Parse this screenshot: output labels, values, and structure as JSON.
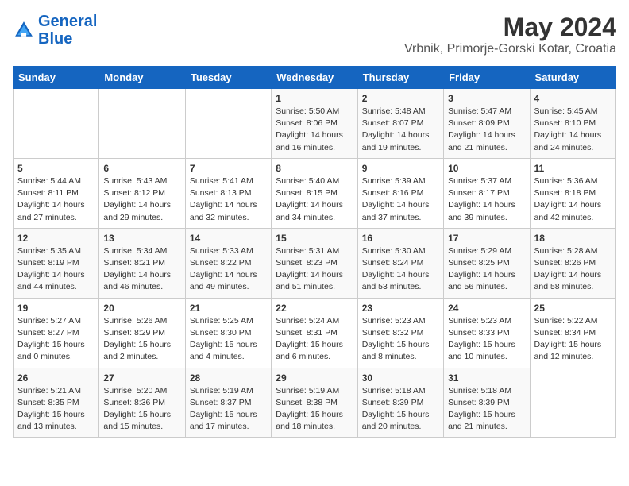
{
  "logo": {
    "line1": "General",
    "line2": "Blue"
  },
  "title": "May 2024",
  "subtitle": "Vrbnik, Primorje-Gorski Kotar, Croatia",
  "days_of_week": [
    "Sunday",
    "Monday",
    "Tuesday",
    "Wednesday",
    "Thursday",
    "Friday",
    "Saturday"
  ],
  "weeks": [
    [
      {
        "day": "",
        "info": ""
      },
      {
        "day": "",
        "info": ""
      },
      {
        "day": "",
        "info": ""
      },
      {
        "day": "1",
        "info": "Sunrise: 5:50 AM\nSunset: 8:06 PM\nDaylight: 14 hours and 16 minutes."
      },
      {
        "day": "2",
        "info": "Sunrise: 5:48 AM\nSunset: 8:07 PM\nDaylight: 14 hours and 19 minutes."
      },
      {
        "day": "3",
        "info": "Sunrise: 5:47 AM\nSunset: 8:09 PM\nDaylight: 14 hours and 21 minutes."
      },
      {
        "day": "4",
        "info": "Sunrise: 5:45 AM\nSunset: 8:10 PM\nDaylight: 14 hours and 24 minutes."
      }
    ],
    [
      {
        "day": "5",
        "info": "Sunrise: 5:44 AM\nSunset: 8:11 PM\nDaylight: 14 hours and 27 minutes."
      },
      {
        "day": "6",
        "info": "Sunrise: 5:43 AM\nSunset: 8:12 PM\nDaylight: 14 hours and 29 minutes."
      },
      {
        "day": "7",
        "info": "Sunrise: 5:41 AM\nSunset: 8:13 PM\nDaylight: 14 hours and 32 minutes."
      },
      {
        "day": "8",
        "info": "Sunrise: 5:40 AM\nSunset: 8:15 PM\nDaylight: 14 hours and 34 minutes."
      },
      {
        "day": "9",
        "info": "Sunrise: 5:39 AM\nSunset: 8:16 PM\nDaylight: 14 hours and 37 minutes."
      },
      {
        "day": "10",
        "info": "Sunrise: 5:37 AM\nSunset: 8:17 PM\nDaylight: 14 hours and 39 minutes."
      },
      {
        "day": "11",
        "info": "Sunrise: 5:36 AM\nSunset: 8:18 PM\nDaylight: 14 hours and 42 minutes."
      }
    ],
    [
      {
        "day": "12",
        "info": "Sunrise: 5:35 AM\nSunset: 8:19 PM\nDaylight: 14 hours and 44 minutes."
      },
      {
        "day": "13",
        "info": "Sunrise: 5:34 AM\nSunset: 8:21 PM\nDaylight: 14 hours and 46 minutes."
      },
      {
        "day": "14",
        "info": "Sunrise: 5:33 AM\nSunset: 8:22 PM\nDaylight: 14 hours and 49 minutes."
      },
      {
        "day": "15",
        "info": "Sunrise: 5:31 AM\nSunset: 8:23 PM\nDaylight: 14 hours and 51 minutes."
      },
      {
        "day": "16",
        "info": "Sunrise: 5:30 AM\nSunset: 8:24 PM\nDaylight: 14 hours and 53 minutes."
      },
      {
        "day": "17",
        "info": "Sunrise: 5:29 AM\nSunset: 8:25 PM\nDaylight: 14 hours and 56 minutes."
      },
      {
        "day": "18",
        "info": "Sunrise: 5:28 AM\nSunset: 8:26 PM\nDaylight: 14 hours and 58 minutes."
      }
    ],
    [
      {
        "day": "19",
        "info": "Sunrise: 5:27 AM\nSunset: 8:27 PM\nDaylight: 15 hours and 0 minutes."
      },
      {
        "day": "20",
        "info": "Sunrise: 5:26 AM\nSunset: 8:29 PM\nDaylight: 15 hours and 2 minutes."
      },
      {
        "day": "21",
        "info": "Sunrise: 5:25 AM\nSunset: 8:30 PM\nDaylight: 15 hours and 4 minutes."
      },
      {
        "day": "22",
        "info": "Sunrise: 5:24 AM\nSunset: 8:31 PM\nDaylight: 15 hours and 6 minutes."
      },
      {
        "day": "23",
        "info": "Sunrise: 5:23 AM\nSunset: 8:32 PM\nDaylight: 15 hours and 8 minutes."
      },
      {
        "day": "24",
        "info": "Sunrise: 5:23 AM\nSunset: 8:33 PM\nDaylight: 15 hours and 10 minutes."
      },
      {
        "day": "25",
        "info": "Sunrise: 5:22 AM\nSunset: 8:34 PM\nDaylight: 15 hours and 12 minutes."
      }
    ],
    [
      {
        "day": "26",
        "info": "Sunrise: 5:21 AM\nSunset: 8:35 PM\nDaylight: 15 hours and 13 minutes."
      },
      {
        "day": "27",
        "info": "Sunrise: 5:20 AM\nSunset: 8:36 PM\nDaylight: 15 hours and 15 minutes."
      },
      {
        "day": "28",
        "info": "Sunrise: 5:19 AM\nSunset: 8:37 PM\nDaylight: 15 hours and 17 minutes."
      },
      {
        "day": "29",
        "info": "Sunrise: 5:19 AM\nSunset: 8:38 PM\nDaylight: 15 hours and 18 minutes."
      },
      {
        "day": "30",
        "info": "Sunrise: 5:18 AM\nSunset: 8:39 PM\nDaylight: 15 hours and 20 minutes."
      },
      {
        "day": "31",
        "info": "Sunrise: 5:18 AM\nSunset: 8:39 PM\nDaylight: 15 hours and 21 minutes."
      },
      {
        "day": "",
        "info": ""
      }
    ]
  ]
}
